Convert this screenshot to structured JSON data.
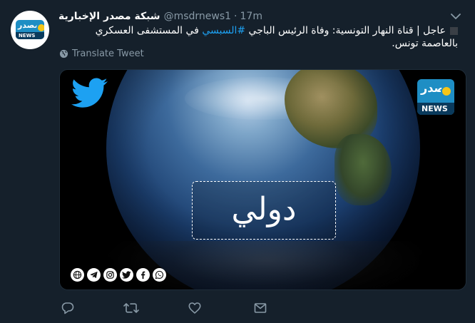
{
  "account": {
    "name": "شبكة مصدر الإخبارية",
    "handle": "@msdrnews1",
    "separator": "·",
    "time": "17m",
    "logo_arabic": "مصدر",
    "logo_news": "NEWS"
  },
  "tweet": {
    "text_before": "عاجل | قناة النهار التونسية: وفاة الرئيس الباجي ",
    "hashtag": "#السبسي",
    "text_after": " في المستشفى العسكري بالعاصمة تونس."
  },
  "translate": {
    "label": "Translate Tweet"
  },
  "media": {
    "label": "دولي",
    "logo_arabic": "مصدر",
    "logo_news": "NEWS",
    "social_icons": [
      "globe-icon",
      "telegram-icon",
      "instagram-icon",
      "twitter-icon",
      "facebook-icon",
      "whatsapp-icon"
    ]
  },
  "actions": [
    "reply-icon",
    "retweet-icon",
    "like-icon",
    "share-icon"
  ],
  "colors": {
    "background": "#15202b",
    "text": "#ffffff",
    "muted": "#8899a6",
    "link": "#1da1f2",
    "twitter_blue": "#1da1f2",
    "logo_blue": "#1e8ec4",
    "logo_yellow": "#f5c518"
  }
}
